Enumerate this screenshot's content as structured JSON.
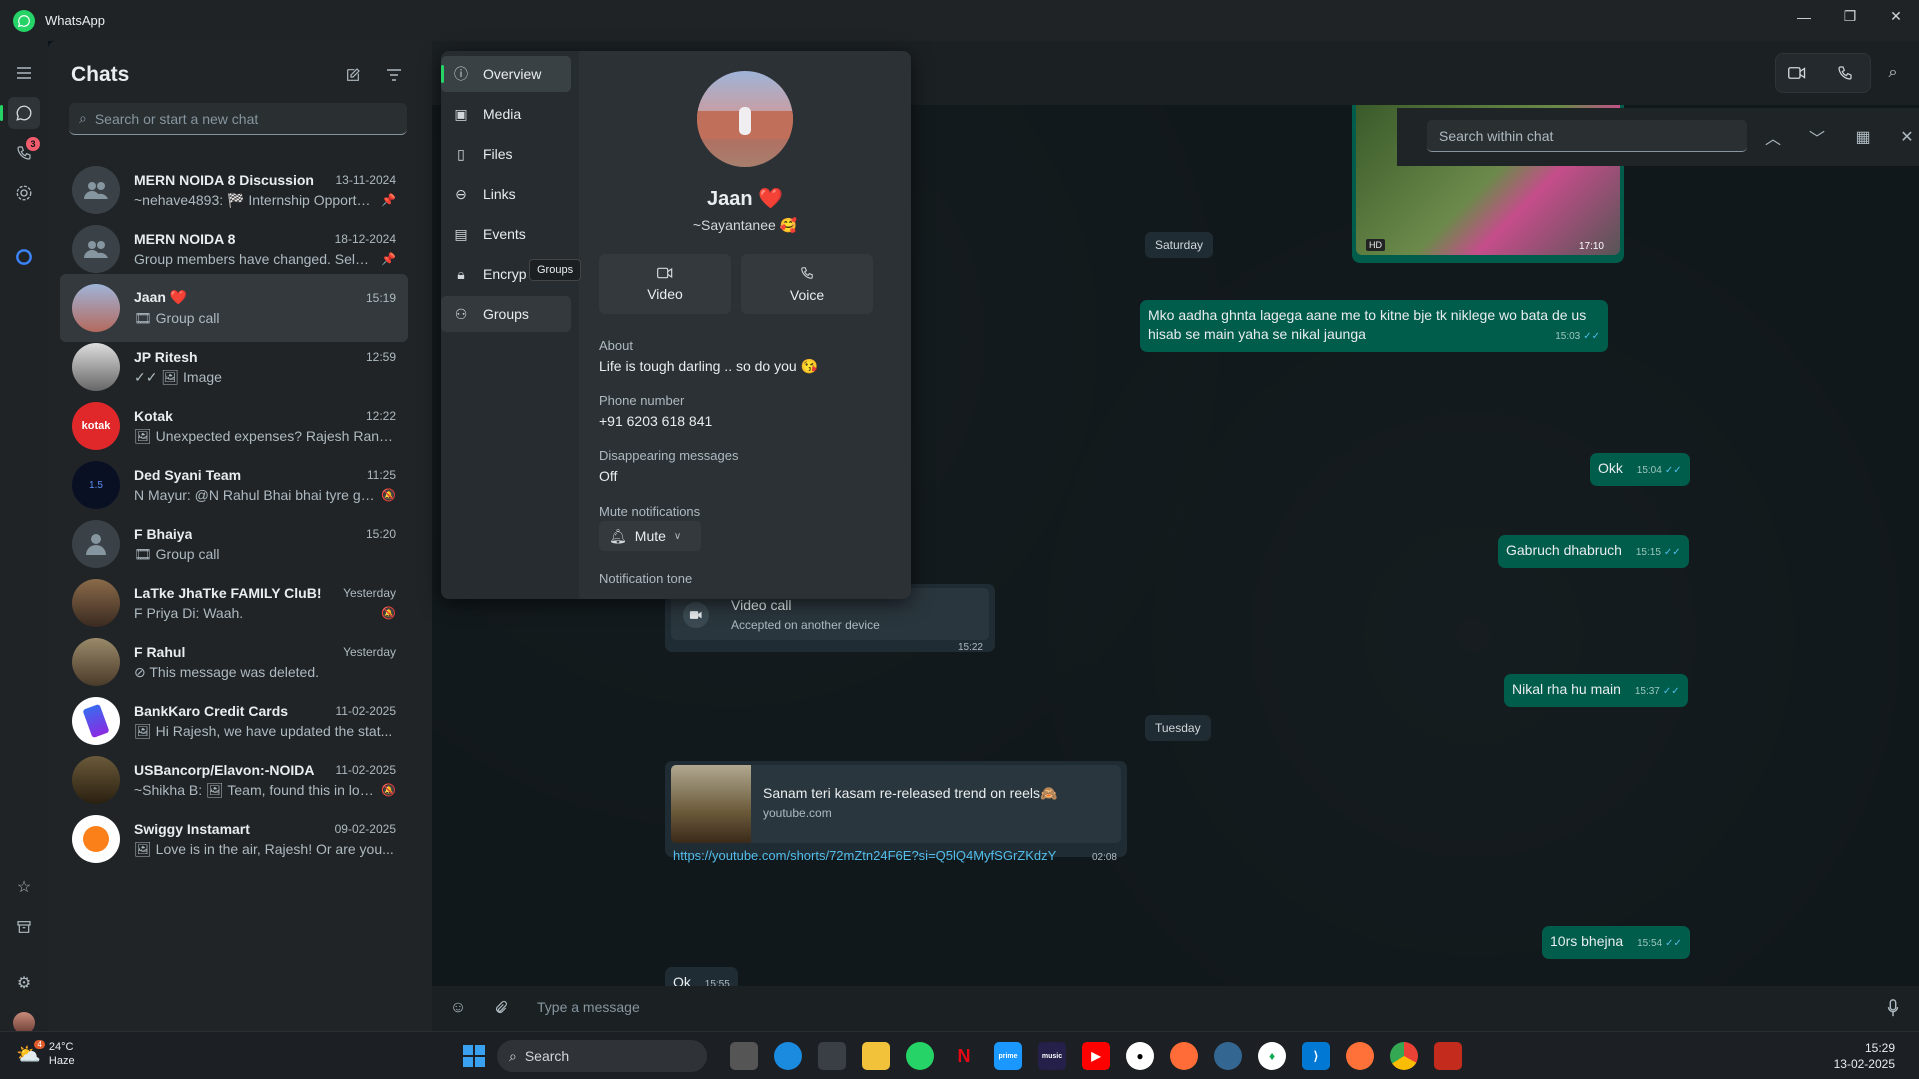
{
  "window": {
    "title": "WhatsApp"
  },
  "rail": {
    "calls_badge": "3"
  },
  "chats": {
    "header": "Chats",
    "search_placeholder": "Search or start a new chat",
    "items": [
      {
        "name": "MERN NOIDA 8 Discussion",
        "time": "13-11-2024",
        "message": "~nehave4893: 🏁 Internship Opportun...",
        "flag": "📌"
      },
      {
        "name": "MERN NOIDA 8",
        "time": "18-12-2024",
        "message": "Group members have changed. Select...",
        "flag": "📌"
      },
      {
        "name": "Jaan ❤️",
        "time": "15:19",
        "message": "🎞 Group call",
        "flag": ""
      },
      {
        "name": "JP Ritesh",
        "time": "12:59",
        "message": "✓✓ 🖼 Image",
        "flag": ""
      },
      {
        "name": "Kotak",
        "time": "12:22",
        "message": "🖼 Unexpected expenses? Rajesh Ranja...",
        "flag": ""
      },
      {
        "name": "Ded Syani Team",
        "time": "11:25",
        "message": "N Mayur: @N Rahul Bhai  bhai tyre go...",
        "flag": "🔕"
      },
      {
        "name": "F Bhaiya",
        "time": "15:20",
        "message": "🎞 Group call",
        "flag": ""
      },
      {
        "name": "LaTke JhaTke FAMILY CluB!",
        "time": "Yesterday",
        "message": "F Priya Di: Waah.",
        "flag": "🔕"
      },
      {
        "name": "F Rahul",
        "time": "Yesterday",
        "message": "⊘ This message was deleted.",
        "flag": ""
      },
      {
        "name": "BankKaro Credit Cards",
        "time": "11-02-2025",
        "message": "🖼 Hi Rajesh, we have updated the stat...",
        "flag": ""
      },
      {
        "name": "USBancorp/Elavon:-NOIDA",
        "time": "11-02-2025",
        "message": "~Shikha B: 🖼 Team, found this in lock...",
        "flag": "🔕"
      },
      {
        "name": "Swiggy Instamart",
        "time": "09-02-2025",
        "message": "🖼 Love is in the air, Rajesh!  Or are you...",
        "flag": ""
      }
    ]
  },
  "info": {
    "nav": [
      "Overview",
      "Media",
      "Files",
      "Links",
      "Events",
      "Encryp",
      "Groups"
    ],
    "tooltip": "Groups",
    "name": "Jaan ❤️",
    "subname": "~Sayantanee 🥰",
    "video_label": "Video",
    "voice_label": "Voice",
    "about_label": "About",
    "about_value": "Life is tough darling .. so do you 😘",
    "phone_label": "Phone number",
    "phone_value": "+91 6203 618 841",
    "disappearing_label": "Disappearing messages",
    "disappearing_value": "Off",
    "mute_label": "Mute notifications",
    "mute_button": "Mute",
    "tone_label": "Notification tone"
  },
  "conversation": {
    "find_placeholder": "Search within chat",
    "media_time": "17:10",
    "day1": "Saturday",
    "day2": "Tuesday",
    "messages": [
      {
        "text": "Mko aadha ghnta lagega aane me to kitne bje tk niklege wo bata de us hisab se main yaha se nikal jaunga",
        "time": "15:03"
      },
      {
        "text": "Okk",
        "time": "15:04"
      },
      {
        "text": "Gabruch dhabruch",
        "time": "15:15"
      },
      {
        "text": "Nikal rha hu main",
        "time": "15:37"
      },
      {
        "text": "10rs bhejna",
        "time": "15:54"
      }
    ],
    "videocall": {
      "title": "Video call",
      "subtitle": "Accepted on another device",
      "time": "15:22"
    },
    "link": {
      "title": "Sanam teri kasam re-released trend on reels🙈",
      "domain": "youtube.com",
      "url": "https://youtube.com/shorts/72mZtn24F6E?si=Q5lQ4MyfSGrZKdzY",
      "time": "02:08"
    },
    "incoming_ok": {
      "text": "Ok",
      "time": "15:55"
    },
    "composer_placeholder": "Type a message"
  },
  "taskbar": {
    "temp": "24°C",
    "weather": "Haze",
    "weather_badge": "4",
    "search": "Search",
    "time": "15:29",
    "date": "13-02-2025"
  },
  "colors": {
    "accent": "#25d366",
    "outgoing_bubble": "#005c4b",
    "incoming_bubble": "#202c33"
  }
}
